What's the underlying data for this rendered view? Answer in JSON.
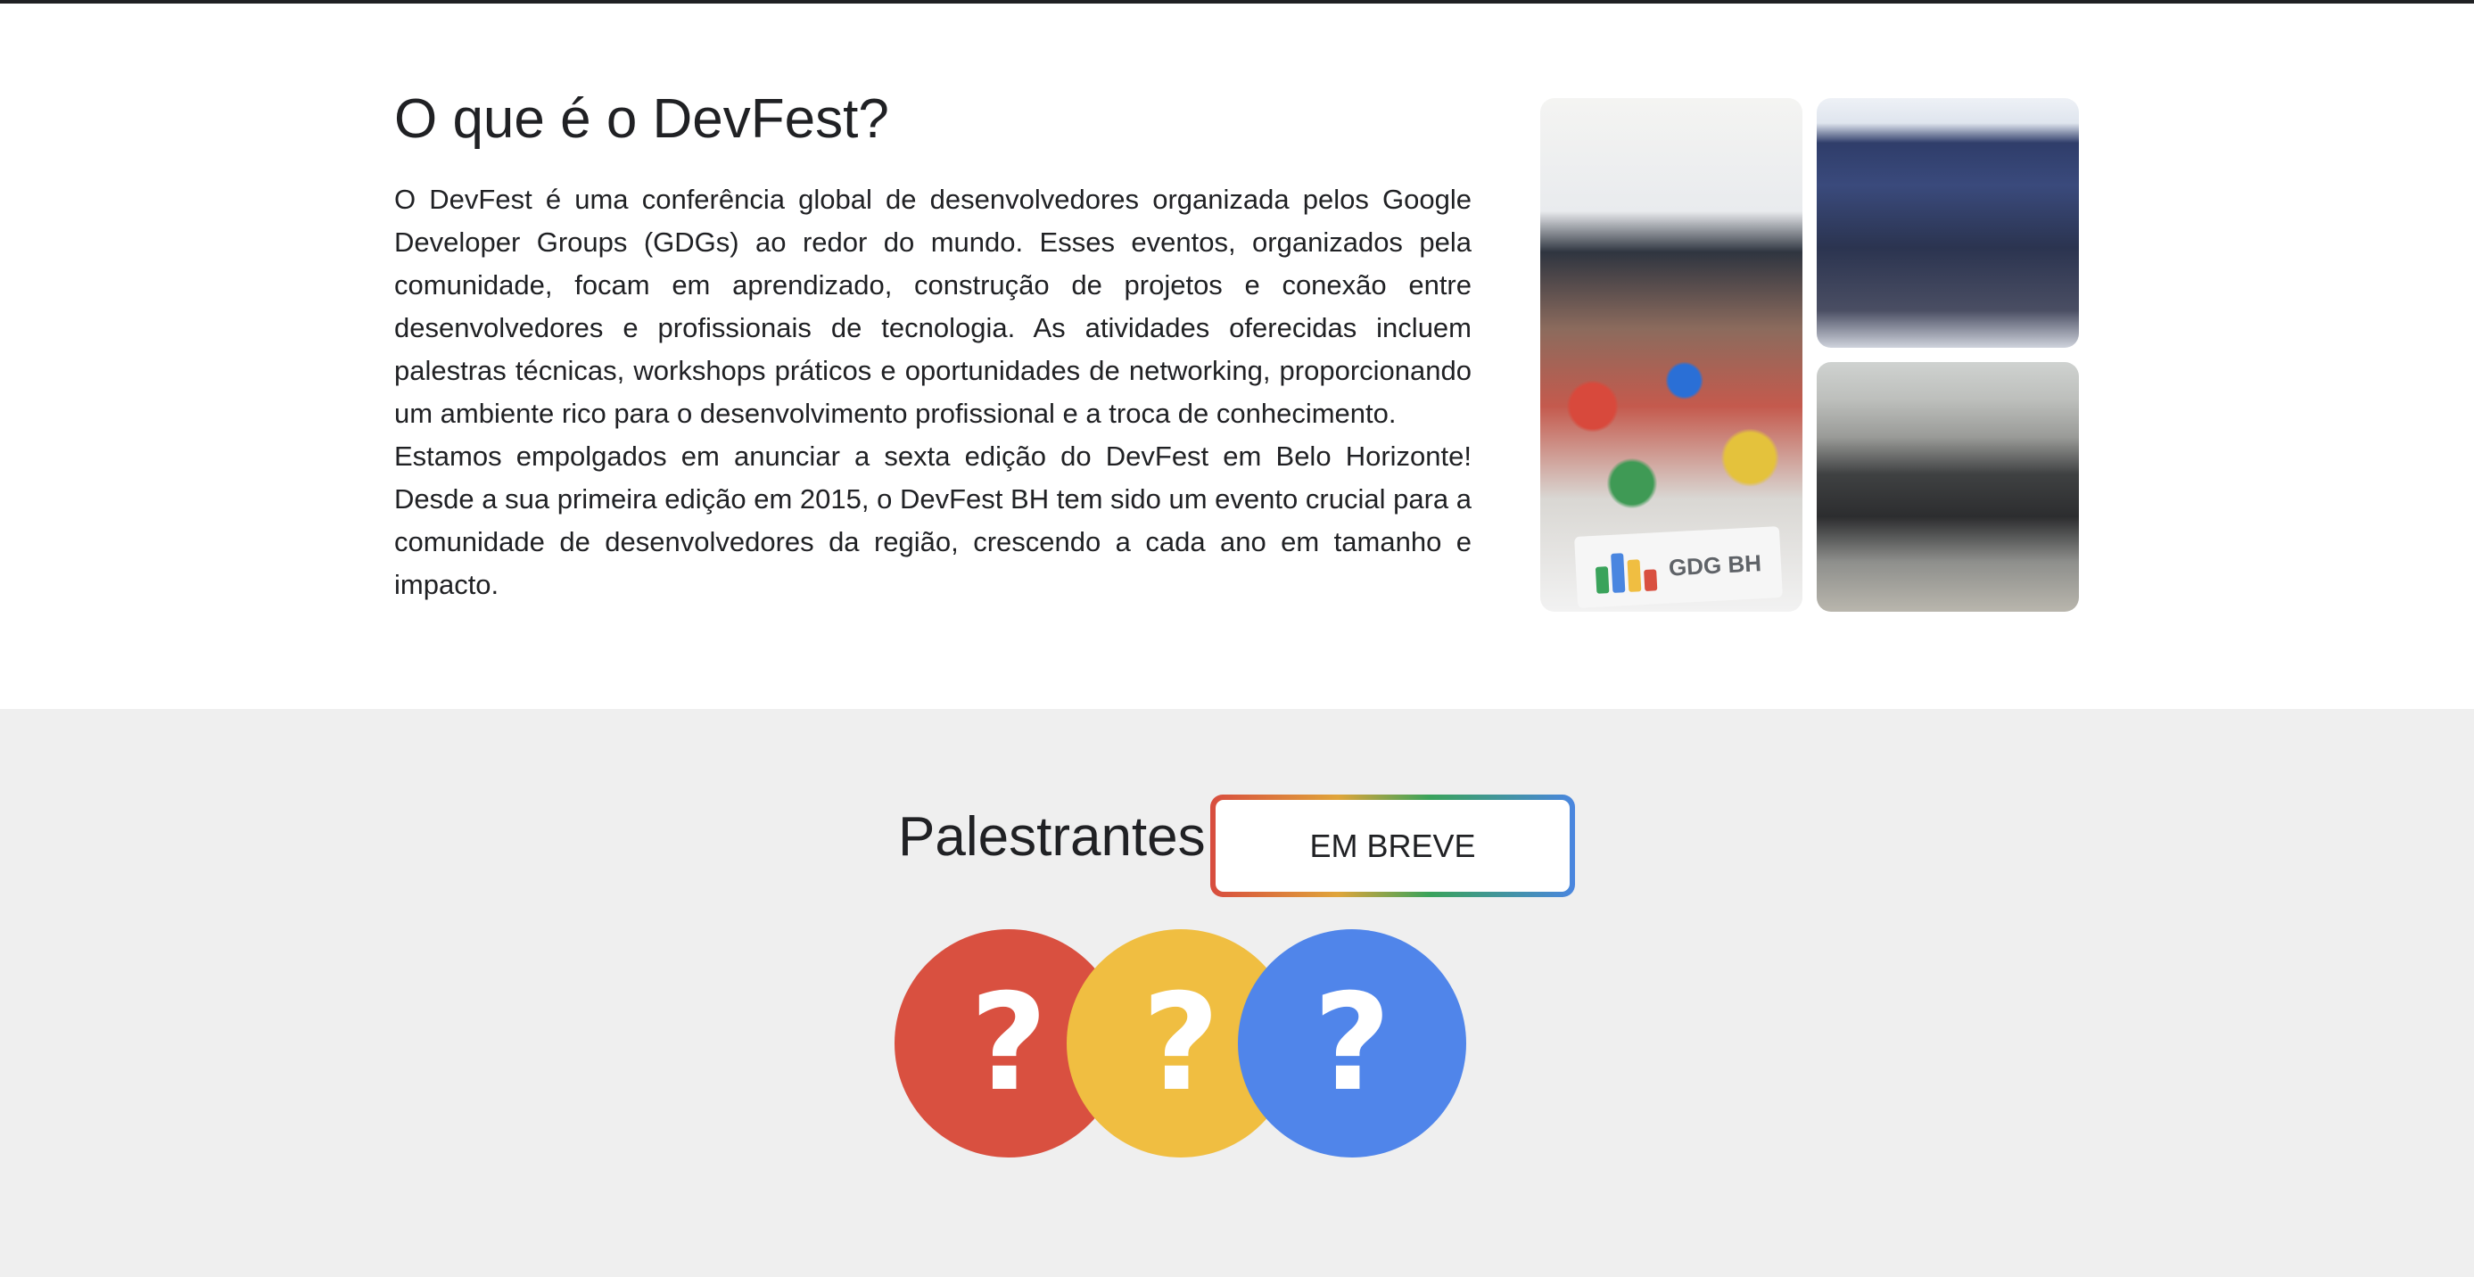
{
  "about": {
    "title": "O que é o DevFest?",
    "paragraph_1": "O DevFest é uma conferência global de desenvolvedores organizada pelos Google Developer Groups (GDGs) ao redor do mundo. Esses eventos, organizados pela comunidade, focam em aprendizado, construção de projetos e conexão entre desenvolvedores e profissionais de tecnologia. As atividades oferecidas incluem palestras técnicas, workshops práticos e oportunidades de networking, proporcionando um ambiente rico para o desenvolvimento profissional e a troca de conhecimento.",
    "paragraph_2": "Estamos empolgados em anunciar a sexta edição do DevFest em Belo Horizonte! Desde a sua primeira edição em 2015, o DevFest BH tem sido um evento crucial para a comunidade de desenvolvedores da região, crescendo a cada ano em tamanho e impacto.",
    "photos": [
      {
        "banner_text": "GDG BH"
      },
      {},
      {}
    ]
  },
  "speakers": {
    "title": "Palestrantes",
    "badge": "EM BREVE",
    "placeholders": [
      {
        "symbol": "?",
        "color": "#d95040"
      },
      {
        "symbol": "?",
        "color": "#f0be41"
      },
      {
        "symbol": "?",
        "color": "#5085ea"
      }
    ]
  }
}
